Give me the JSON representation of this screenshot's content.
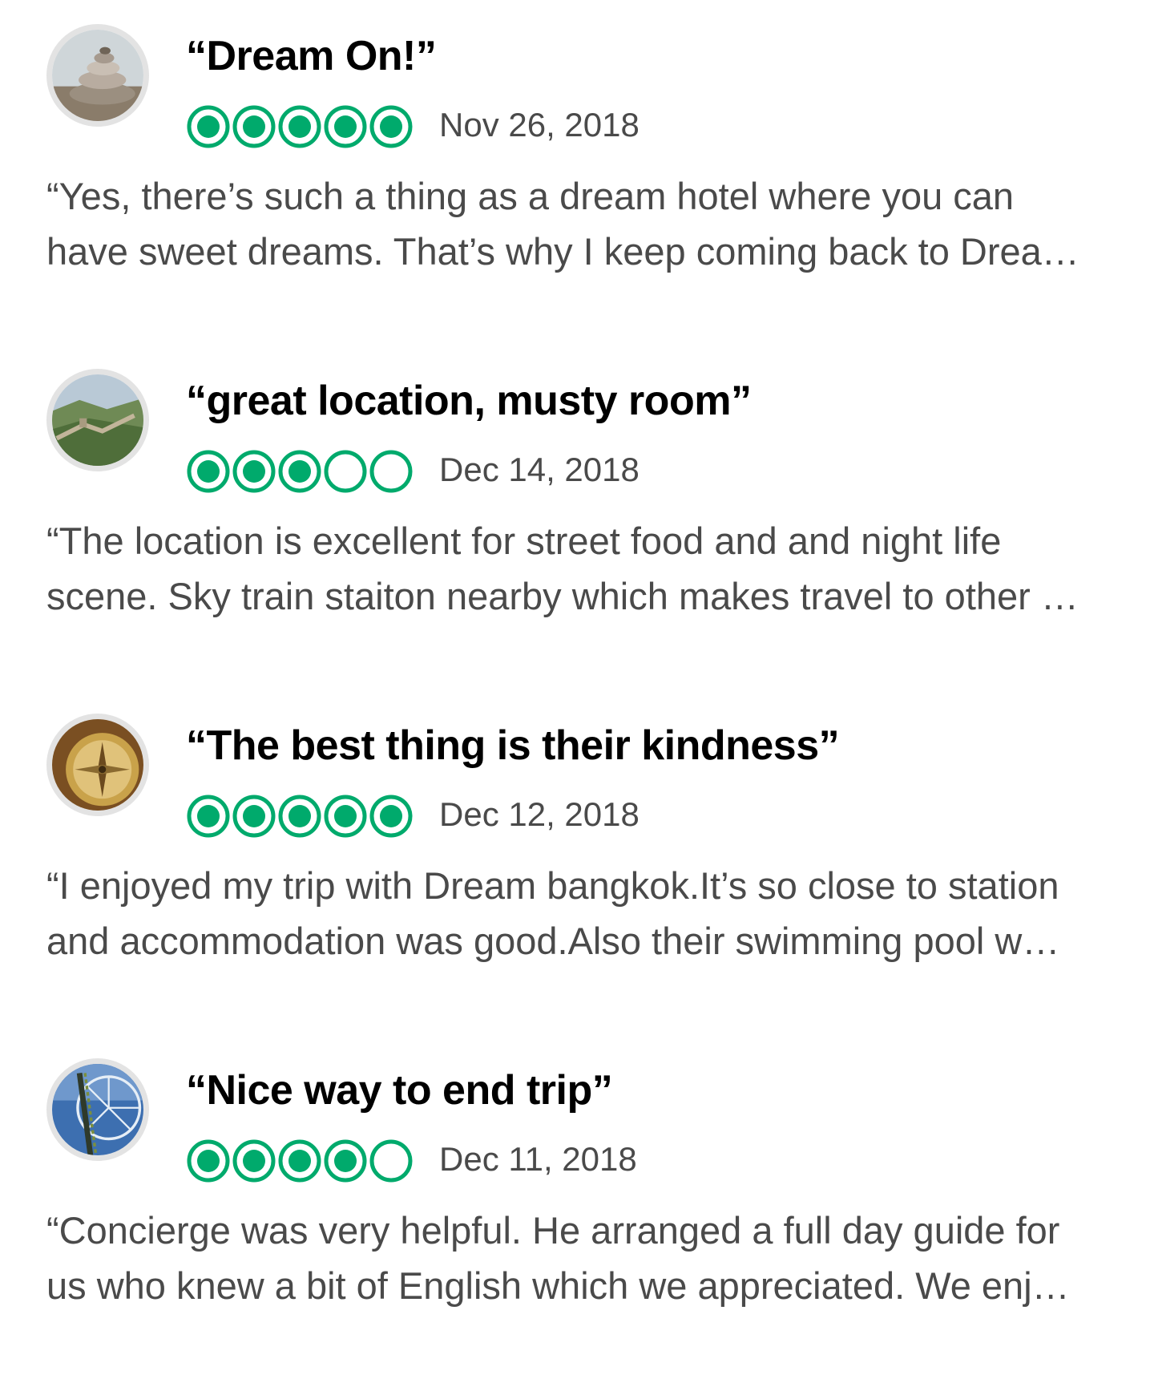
{
  "accent_color": "#00aa6c",
  "reviews": [
    {
      "title": "“Dream On!”",
      "rating": 5,
      "max_rating": 5,
      "date": "Nov 26, 2018",
      "avatar_icon": "stacked-stones-avatar",
      "snippet_line1": "“Yes, there’s such a thing as a dream hotel where you can",
      "snippet_line2": "have sweet dreams. That’s why I keep coming back to Drea…"
    },
    {
      "title": "“great location, musty room”",
      "rating": 3,
      "max_rating": 5,
      "date": "Dec 14, 2018",
      "avatar_icon": "great-wall-avatar",
      "snippet_line1": "“The location is excellent for street food and and night life",
      "snippet_line2": "scene. Sky train staiton nearby which makes travel to other …"
    },
    {
      "title": "“The best thing is their kindness”",
      "rating": 5,
      "max_rating": 5,
      "date": "Dec 12, 2018",
      "avatar_icon": "compass-avatar",
      "snippet_line1": "“I enjoyed my trip with Dream bangkok.It’s so close to station",
      "snippet_line2": "and accommodation was good.Also their swimming pool w…"
    },
    {
      "title": "“Nice way to end trip”",
      "rating": 4,
      "max_rating": 5,
      "date": "Dec 11, 2018",
      "avatar_icon": "ferris-wheel-avatar",
      "snippet_line1": "“Concierge was very helpful. He arranged a full day guide for",
      "snippet_line2": "us who knew a bit of English which we appreciated. We enj…"
    }
  ]
}
